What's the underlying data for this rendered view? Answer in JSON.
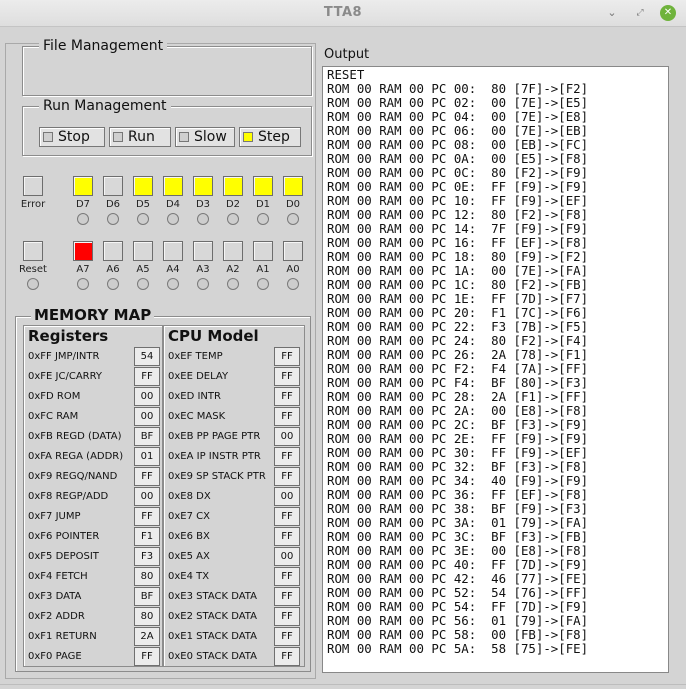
{
  "window": {
    "title": "TTA8"
  },
  "file_management": {
    "title": "File Management"
  },
  "run_management": {
    "title": "Run Management",
    "buttons": [
      {
        "label": "Stop",
        "checked": false
      },
      {
        "label": "Run",
        "checked": false
      },
      {
        "label": "Slow",
        "checked": false
      },
      {
        "label": "Step",
        "checked": true
      }
    ]
  },
  "panel": {
    "error_label": "Error",
    "reset_label": "Reset",
    "data_bits": [
      {
        "label": "D7",
        "on": true
      },
      {
        "label": "D6",
        "on": false
      },
      {
        "label": "D5",
        "on": true
      },
      {
        "label": "D4",
        "on": true
      },
      {
        "label": "D3",
        "on": true
      },
      {
        "label": "D2",
        "on": true
      },
      {
        "label": "D1",
        "on": true
      },
      {
        "label": "D0",
        "on": true
      }
    ],
    "addr_bits": [
      {
        "label": "A7",
        "on": true
      },
      {
        "label": "A6",
        "on": false
      },
      {
        "label": "A5",
        "on": false
      },
      {
        "label": "A4",
        "on": false
      },
      {
        "label": "A3",
        "on": false
      },
      {
        "label": "A2",
        "on": false
      },
      {
        "label": "A1",
        "on": false
      },
      {
        "label": "A0",
        "on": false
      }
    ],
    "colors": {
      "data_on": "#ffff00",
      "addr_on": "#ff0000",
      "off": "#d8d8d8"
    }
  },
  "memory_map": {
    "title": "MEMORY MAP",
    "registers_title": "Registers",
    "cpu_title": "CPU Model",
    "registers": [
      {
        "name": "0xFF JMP/INTR",
        "value": "54"
      },
      {
        "name": "0xFE JC/CARRY",
        "value": "FF"
      },
      {
        "name": "0xFD ROM",
        "value": "00"
      },
      {
        "name": "0xFC RAM",
        "value": "00"
      },
      {
        "name": "0xFB REGD (DATA)",
        "value": "BF"
      },
      {
        "name": "0xFA REGA (ADDR)",
        "value": "01"
      },
      {
        "name": "0xF9 REGQ/NAND",
        "value": "FF"
      },
      {
        "name": "0xF8 REGP/ADD",
        "value": "00"
      },
      {
        "name": "0xF7 JUMP",
        "value": "FF"
      },
      {
        "name": "0xF6 POINTER",
        "value": "F1"
      },
      {
        "name": "0xF5 DEPOSIT",
        "value": "F3"
      },
      {
        "name": "0xF4 FETCH",
        "value": "80"
      },
      {
        "name": "0xF3 DATA",
        "value": "BF"
      },
      {
        "name": "0xF2 ADDR",
        "value": "80"
      },
      {
        "name": "0xF1 RETURN",
        "value": "2A"
      },
      {
        "name": "0xF0 PAGE",
        "value": "FF"
      }
    ],
    "cpu": [
      {
        "name": "0xEF TEMP",
        "value": "FF"
      },
      {
        "name": "0xEE DELAY",
        "value": "FF"
      },
      {
        "name": "0xED INTR",
        "value": "FF"
      },
      {
        "name": "0xEC MASK",
        "value": "FF"
      },
      {
        "name": "0xEB PP PAGE PTR",
        "value": "00"
      },
      {
        "name": "0xEA IP INSTR PTR",
        "value": "FF"
      },
      {
        "name": "0xE9 SP STACK PTR",
        "value": "FF"
      },
      {
        "name": "0xE8 DX",
        "value": "00"
      },
      {
        "name": "0xE7 CX",
        "value": "FF"
      },
      {
        "name": "0xE6 BX",
        "value": "FF"
      },
      {
        "name": "0xE5 AX",
        "value": "00"
      },
      {
        "name": "0xE4 TX",
        "value": "FF"
      },
      {
        "name": "0xE3 STACK DATA",
        "value": "FF"
      },
      {
        "name": "0xE2 STACK DATA",
        "value": "FF"
      },
      {
        "name": "0xE1 STACK DATA",
        "value": "FF"
      },
      {
        "name": "0xE0 STACK DATA",
        "value": "FF"
      }
    ]
  },
  "output": {
    "label": "Output",
    "lines": [
      "RESET",
      "ROM 00 RAM 00 PC 00:  80 [7F]->[F2]",
      "ROM 00 RAM 00 PC 02:  00 [7E]->[E5]",
      "ROM 00 RAM 00 PC 04:  00 [7E]->[E8]",
      "ROM 00 RAM 00 PC 06:  00 [7E]->[EB]",
      "ROM 00 RAM 00 PC 08:  00 [EB]->[FC]",
      "ROM 00 RAM 00 PC 0A:  00 [E5]->[F8]",
      "ROM 00 RAM 00 PC 0C:  80 [F2]->[F9]",
      "ROM 00 RAM 00 PC 0E:  FF [F9]->[F9]",
      "ROM 00 RAM 00 PC 10:  FF [F9]->[EF]",
      "ROM 00 RAM 00 PC 12:  80 [F2]->[F8]",
      "ROM 00 RAM 00 PC 14:  7F [F9]->[F9]",
      "ROM 00 RAM 00 PC 16:  FF [EF]->[F8]",
      "ROM 00 RAM 00 PC 18:  80 [F9]->[F2]",
      "ROM 00 RAM 00 PC 1A:  00 [7E]->[FA]",
      "ROM 00 RAM 00 PC 1C:  80 [F2]->[FB]",
      "ROM 00 RAM 00 PC 1E:  FF [7D]->[F7]",
      "ROM 00 RAM 00 PC 20:  F1 [7C]->[F6]",
      "ROM 00 RAM 00 PC 22:  F3 [7B]->[F5]",
      "ROM 00 RAM 00 PC 24:  80 [F2]->[F4]",
      "ROM 00 RAM 00 PC 26:  2A [78]->[F1]",
      "ROM 00 RAM 00 PC F2:  F4 [7A]->[FF]",
      "ROM 00 RAM 00 PC F4:  BF [80]->[F3]",
      "ROM 00 RAM 00 PC 28:  2A [F1]->[FF]",
      "ROM 00 RAM 00 PC 2A:  00 [E8]->[F8]",
      "ROM 00 RAM 00 PC 2C:  BF [F3]->[F9]",
      "ROM 00 RAM 00 PC 2E:  FF [F9]->[F9]",
      "ROM 00 RAM 00 PC 30:  FF [F9]->[EF]",
      "ROM 00 RAM 00 PC 32:  BF [F3]->[F8]",
      "ROM 00 RAM 00 PC 34:  40 [F9]->[F9]",
      "ROM 00 RAM 00 PC 36:  FF [EF]->[F8]",
      "ROM 00 RAM 00 PC 38:  BF [F9]->[F3]",
      "ROM 00 RAM 00 PC 3A:  01 [79]->[FA]",
      "ROM 00 RAM 00 PC 3C:  BF [F3]->[FB]",
      "ROM 00 RAM 00 PC 3E:  00 [E8]->[F8]",
      "ROM 00 RAM 00 PC 40:  FF [7D]->[F9]",
      "ROM 00 RAM 00 PC 42:  46 [77]->[FE]",
      "ROM 00 RAM 00 PC 52:  54 [76]->[FF]",
      "ROM 00 RAM 00 PC 54:  FF [7D]->[F9]",
      "ROM 00 RAM 00 PC 56:  01 [79]->[FA]",
      "ROM 00 RAM 00 PC 58:  00 [FB]->[F8]",
      "ROM 00 RAM 00 PC 5A:  58 [75]->[FE]"
    ]
  }
}
